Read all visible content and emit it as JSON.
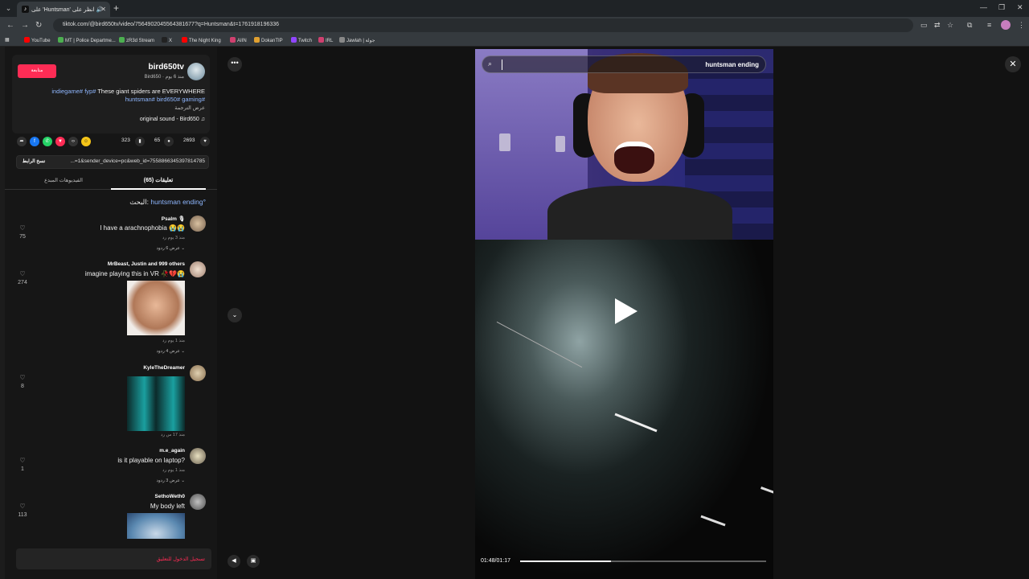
{
  "browser": {
    "tab_title": "على 'Huntsman' انظر على 🔊",
    "url": "tiktok.com/@bird650tv/video/7564902045564381677?q=Huntsman&t=1761918196336",
    "bookmarks": [
      "YouTube",
      "MT | Police Departme...",
      "zR3d Stream",
      "X",
      "The Night King",
      "AIIN",
      "DokanTIP",
      "Twitch",
      "IRL",
      "Jawlah | جولة"
    ],
    "bookmark_colors": [
      "#ff0000",
      "#4caf50",
      "#4caf50",
      "#222222",
      "#ff0000",
      "#d0406f",
      "#e0a030",
      "#9146ff",
      "#d0406f",
      "#888888"
    ]
  },
  "author": {
    "follow_label": "متابعة",
    "name": "bird650tv",
    "sub": "Bird650 · منذ 6 يوم",
    "desc_text": "These giant spiders are EVERYWHERE",
    "desc_tags_1": "indiegame# fyp#",
    "desc_tags_2": "huntsman# bird650# gaming#",
    "translate": "عرض الترجمة",
    "sound": "original sound - Bird650"
  },
  "stats": {
    "likes": "2693",
    "comments": "65",
    "saves": "323"
  },
  "link": {
    "copy_label": "نسخ الرابط",
    "url_tail": "...=1&sender_device=pc&web_id=7558866345397814785"
  },
  "tabs": {
    "comments": "تعليقات (65)",
    "creator": "الفيديوهات المبدع"
  },
  "search_hint": {
    "prefix": "البحث:",
    "query": "huntsman ending"
  },
  "comments": [
    {
      "author": "Psalm 🎙",
      "text": "I have a arachnophobia 😭😭",
      "meta": "منذ 3 يوم   رد",
      "replies": "عرض 6 ردود",
      "likes": "75"
    },
    {
      "author": "MrBeast, Justin and 999 others",
      "text": "imagine playing this in VR 🥀💔😭",
      "meta": "منذ 1 يوم   رد",
      "replies": "عرض 4 ردود",
      "likes": "274"
    },
    {
      "author": "KyleTheDreamer",
      "text": "",
      "meta": "منذ 17 س   رد",
      "replies": "",
      "likes": "8"
    },
    {
      "author": "m.e_again",
      "text": "is it playable on laptop?",
      "meta": "منذ 1 يوم   رد",
      "replies": "عرض 3 ردود",
      "likes": "1"
    },
    {
      "author": "SethoWeth0",
      "text": "My body left",
      "meta": "",
      "replies": "",
      "likes": "113"
    }
  ],
  "comment_input": {
    "label": "تسجيل الدخول للتعليق"
  },
  "video": {
    "search_query": "huntsman ending",
    "time": "01:48/01:17",
    "progress": 0.37
  }
}
